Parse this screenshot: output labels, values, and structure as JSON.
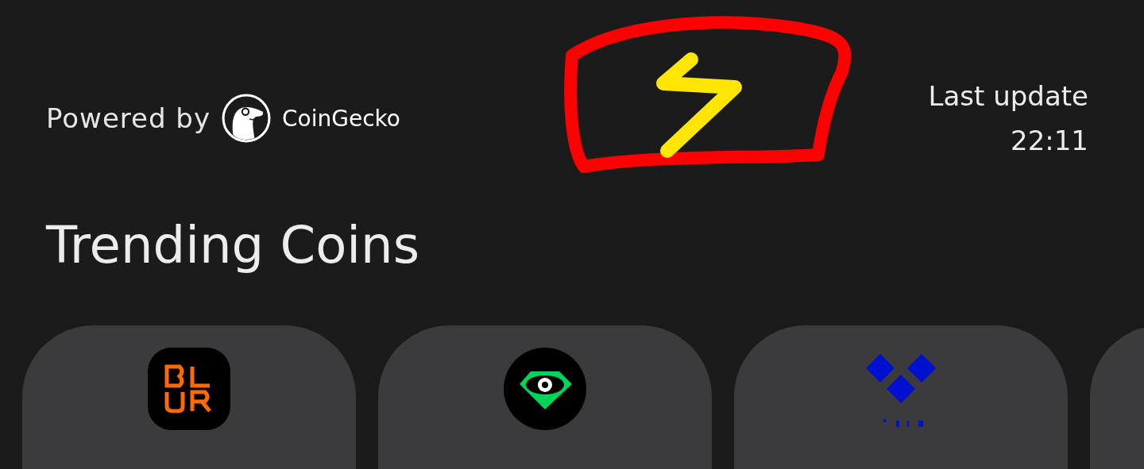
{
  "header": {
    "powered_by": "Powered by",
    "brand": "CoinGecko",
    "last_update_label": "Last update",
    "last_update_time": "22:11"
  },
  "section_title": "Trending Coins",
  "coins": [
    {
      "kind": "blur"
    },
    {
      "kind": "eye"
    },
    {
      "kind": "diamond"
    },
    {
      "kind": "blank"
    }
  ]
}
